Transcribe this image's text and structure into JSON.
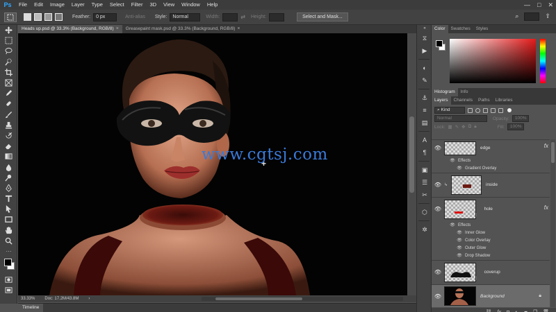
{
  "app": {
    "logo": "Ps"
  },
  "menu": [
    "File",
    "Edit",
    "Image",
    "Layer",
    "Type",
    "Select",
    "Filter",
    "3D",
    "View",
    "Window",
    "Help"
  ],
  "window_controls": [
    "—",
    "□",
    "✕"
  ],
  "options": {
    "feather_label": "Feather:",
    "feather_value": "0 px",
    "antialias_label": "Anti-alias",
    "style_label": "Style:",
    "style_value": "Normal",
    "width_label": "Width:",
    "height_label": "Height:",
    "select_mask_label": "Select and Mask..."
  },
  "doc_tabs": [
    {
      "label": "Heads up.psd @ 33.3% (Background, RGB/8)",
      "active": true
    },
    {
      "label": "Greasepaint mask.psd @ 33.3% (Background, RGB/8)",
      "active": false
    }
  ],
  "canvas": {
    "watermark": "www.cgtsj.com"
  },
  "status": {
    "zoom": "33.33%",
    "doc": "Doc: 17.2M/43.8M",
    "arrow": "›"
  },
  "timeline": {
    "label": "Timeline"
  },
  "panels": {
    "color_tabs": [
      "Color",
      "Swatches",
      "Styles"
    ],
    "histogram_tabs": [
      "Histogram",
      "Info"
    ],
    "layers_tabs": [
      "Layers",
      "Channels",
      "Paths",
      "Libraries"
    ],
    "kind_label": "Kind",
    "blend_mode": "Normal",
    "opacity_label": "Opacity:",
    "opacity_value": "100%",
    "lock_label": "Lock:",
    "fill_label": "Fill:",
    "fill_value": "100%"
  },
  "layers": [
    {
      "name": "edge",
      "fx": "fx",
      "effects_label": "Effects",
      "effects": [
        "Gradient Overlay"
      ]
    },
    {
      "name": "inside"
    },
    {
      "name": "hole",
      "fx": "fx",
      "effects_label": "Effects",
      "effects": [
        "Inner Glow",
        "Color Overlay",
        "Outer Glow",
        "Drop Shadow"
      ]
    },
    {
      "name": "coverup"
    },
    {
      "name": "Background"
    }
  ],
  "colors": {
    "accent": "#31a8ff",
    "watermark": "#3a7ad8",
    "panel_bg": "#535353",
    "chrome_dark": "#424242"
  }
}
